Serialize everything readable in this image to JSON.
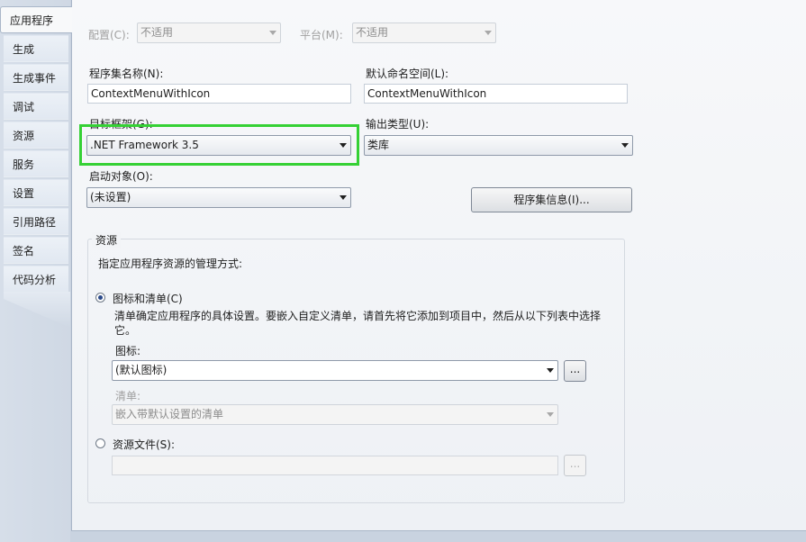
{
  "tabs": [
    {
      "label": "应用程序",
      "active": true
    },
    {
      "label": "生成"
    },
    {
      "label": "生成事件"
    },
    {
      "label": "调试"
    },
    {
      "label": "资源"
    },
    {
      "label": "服务"
    },
    {
      "label": "设置"
    },
    {
      "label": "引用路径"
    },
    {
      "label": "签名"
    },
    {
      "label": "代码分析"
    }
  ],
  "toolbar": {
    "config_label": "配置(C):",
    "config_value": "不适用",
    "platform_label": "平台(M):",
    "platform_value": "不适用"
  },
  "assembly": {
    "name_label": "程序集名称(N):",
    "name_value": "ContextMenuWithIcon",
    "namespace_label": "默认命名空间(L):",
    "namespace_value": "ContextMenuWithIcon"
  },
  "framework": {
    "label": "目标框架(G):",
    "value": ".NET Framework 3.5"
  },
  "output": {
    "label": "输出类型(U):",
    "value": "类库"
  },
  "startup": {
    "label": "启动对象(O):",
    "value": "(未设置)"
  },
  "assembly_info_button": "程序集信息(I)...",
  "resources": {
    "title": "资源",
    "description": "指定应用程序资源的管理方式:",
    "icon_manifest_radio": "图标和清单(C)",
    "icon_manifest_desc": "清单确定应用程序的具体设置。要嵌入自定义清单，请首先将它添加到项目中，然后从以下列表中选择它。",
    "icon_label": "图标:",
    "icon_value": "(默认图标)",
    "browse": "...",
    "manifest_label": "清单:",
    "manifest_value": "嵌入带默认设置的清单",
    "resource_file_radio": "资源文件(S):",
    "resource_file_value": ""
  },
  "colors": {
    "highlight": "#35d135",
    "selected_radio": "#2b4a8a"
  }
}
